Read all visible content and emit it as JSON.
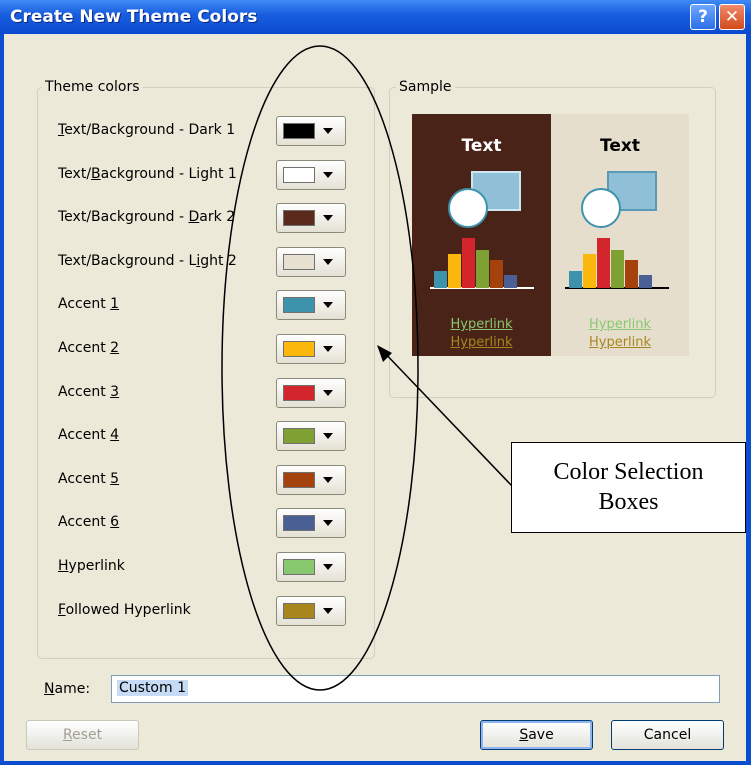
{
  "window": {
    "title": "Create New Theme Colors",
    "help_glyph": "?",
    "close_glyph": "✕"
  },
  "theme_colors": {
    "group_label": "Theme colors",
    "rows": [
      {
        "pre": "",
        "ul": "T",
        "post": "ext/Background - Dark 1",
        "color": "#000000"
      },
      {
        "pre": "Text/",
        "ul": "B",
        "post": "ackground - Light 1",
        "color": "#ffffff"
      },
      {
        "pre": "Text/Background - ",
        "ul": "D",
        "post": "ark 2",
        "color": "#5a2a1c"
      },
      {
        "pre": "Text/Background - L",
        "ul": "i",
        "post": "ght 2",
        "color": "#e8e0d0"
      },
      {
        "pre": "Accent ",
        "ul": "1",
        "post": "",
        "color": "#3d93ab"
      },
      {
        "pre": "Accent ",
        "ul": "2",
        "post": "",
        "color": "#fbb70b"
      },
      {
        "pre": "Accent ",
        "ul": "3",
        "post": "",
        "color": "#d2262c"
      },
      {
        "pre": "Accent ",
        "ul": "4",
        "post": "",
        "color": "#7fa033"
      },
      {
        "pre": "Accent ",
        "ul": "5",
        "post": "",
        "color": "#a4410c"
      },
      {
        "pre": "Accent ",
        "ul": "6",
        "post": "",
        "color": "#4a5f94"
      },
      {
        "pre": "",
        "ul": "H",
        "post": "yperlink",
        "color": "#88c86e"
      },
      {
        "pre": "",
        "ul": "F",
        "post": "ollowed Hyperlink",
        "color": "#a8861e"
      }
    ]
  },
  "sample": {
    "group_label": "Sample",
    "text_label": "Text",
    "hyperlink_label": "Hyperlink",
    "followed_label": "Hyperlink"
  },
  "name_field": {
    "label_ul": "N",
    "label_rest": "ame:",
    "value": "Custom 1"
  },
  "buttons": {
    "reset_ul": "R",
    "reset_rest": "eset",
    "save_ul": "S",
    "save_rest": "ave",
    "cancel": "Cancel"
  },
  "annotation": {
    "callout_line1": "Color Selection",
    "callout_line2": "Boxes"
  }
}
